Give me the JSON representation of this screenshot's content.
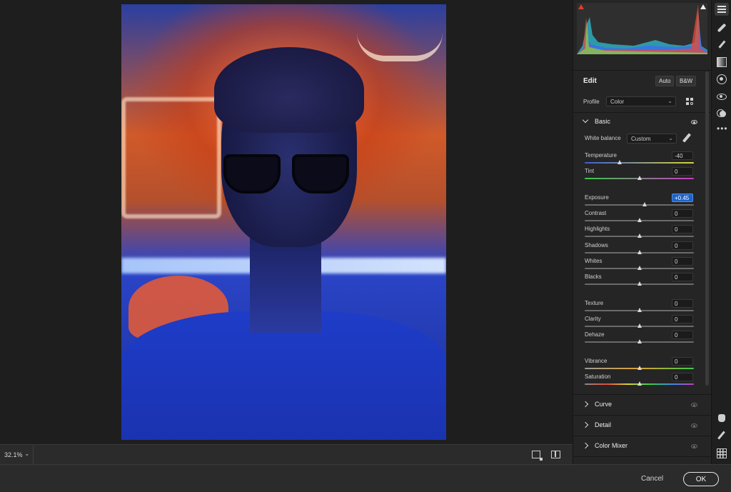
{
  "canvas": {
    "zoom": "32.1%",
    "zoom_caret": "⌄"
  },
  "panel": {
    "edit_title": "Edit",
    "auto_label": "Auto",
    "bw_label": "B&W",
    "profile_label": "Profile",
    "profile_value": "Color",
    "basic": {
      "title": "Basic",
      "white_balance_label": "White balance",
      "white_balance_value": "Custom",
      "sliders": [
        {
          "label": "Temperature",
          "value": "-40",
          "position": 0.32,
          "track": "temperature"
        },
        {
          "label": "Tint",
          "value": "0",
          "position": 0.5,
          "track": "tint"
        },
        {
          "label": "Exposure",
          "value": "+0.45",
          "position": 0.55,
          "track": "neutral"
        },
        {
          "label": "Contrast",
          "value": "0",
          "position": 0.5,
          "track": "neutral"
        },
        {
          "label": "Highlights",
          "value": "0",
          "position": 0.5,
          "track": "neutral"
        },
        {
          "label": "Shadows",
          "value": "0",
          "position": 0.5,
          "track": "neutral"
        },
        {
          "label": "Whites",
          "value": "0",
          "position": 0.5,
          "track": "neutral"
        },
        {
          "label": "Blacks",
          "value": "0",
          "position": 0.5,
          "track": "neutral"
        },
        {
          "label": "Texture",
          "value": "0",
          "position": 0.5,
          "track": "neutral"
        },
        {
          "label": "Clarity",
          "value": "0",
          "position": 0.5,
          "track": "neutral"
        },
        {
          "label": "Dehaze",
          "value": "0",
          "position": 0.5,
          "track": "neutral"
        },
        {
          "label": "Vibrance",
          "value": "0",
          "position": 0.5,
          "track": "vibrance"
        },
        {
          "label": "Saturation",
          "value": "0",
          "position": 0.5,
          "track": "saturation"
        }
      ]
    },
    "sections": [
      {
        "title": "Curve"
      },
      {
        "title": "Detail"
      },
      {
        "title": "Color Mixer"
      }
    ]
  },
  "footer": {
    "cancel_label": "Cancel",
    "ok_label": "OK"
  },
  "colors": {
    "accent": "#1e63c8",
    "panel_bg": "#252525",
    "canvas_bg": "#1e1e1e"
  }
}
